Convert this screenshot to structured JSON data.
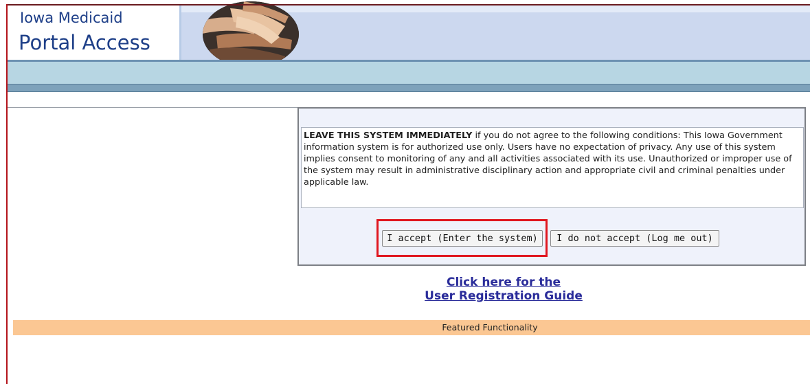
{
  "header": {
    "title_line1": "Iowa Medicaid",
    "title_line2": "Portal Access",
    "photo_icon": "joined-hands-photo"
  },
  "notice": {
    "lead": "LEAVE THIS SYSTEM IMMEDIATELY",
    "body": " if you do not agree to the following conditions: This Iowa Government information system is for authorized use only. Users have no expectation of privacy. Any use of this system implies consent to monitoring of any and all activities associated with its use. Unauthorized or improper use of the system may result in administrative disciplinary action and appropriate civil and criminal penalties under applicable law."
  },
  "buttons": {
    "accept_label": "I accept (Enter the system)",
    "decline_label": "I do not accept (Log me out)"
  },
  "guide_link": {
    "line1": "Click here for the",
    "line2": "User Registration Guide"
  },
  "featured": {
    "label": "Featured Functionality"
  },
  "colors": {
    "highlight": "#e0161f",
    "brand_text": "#1e3f88",
    "featured_bar": "#fbc793"
  }
}
